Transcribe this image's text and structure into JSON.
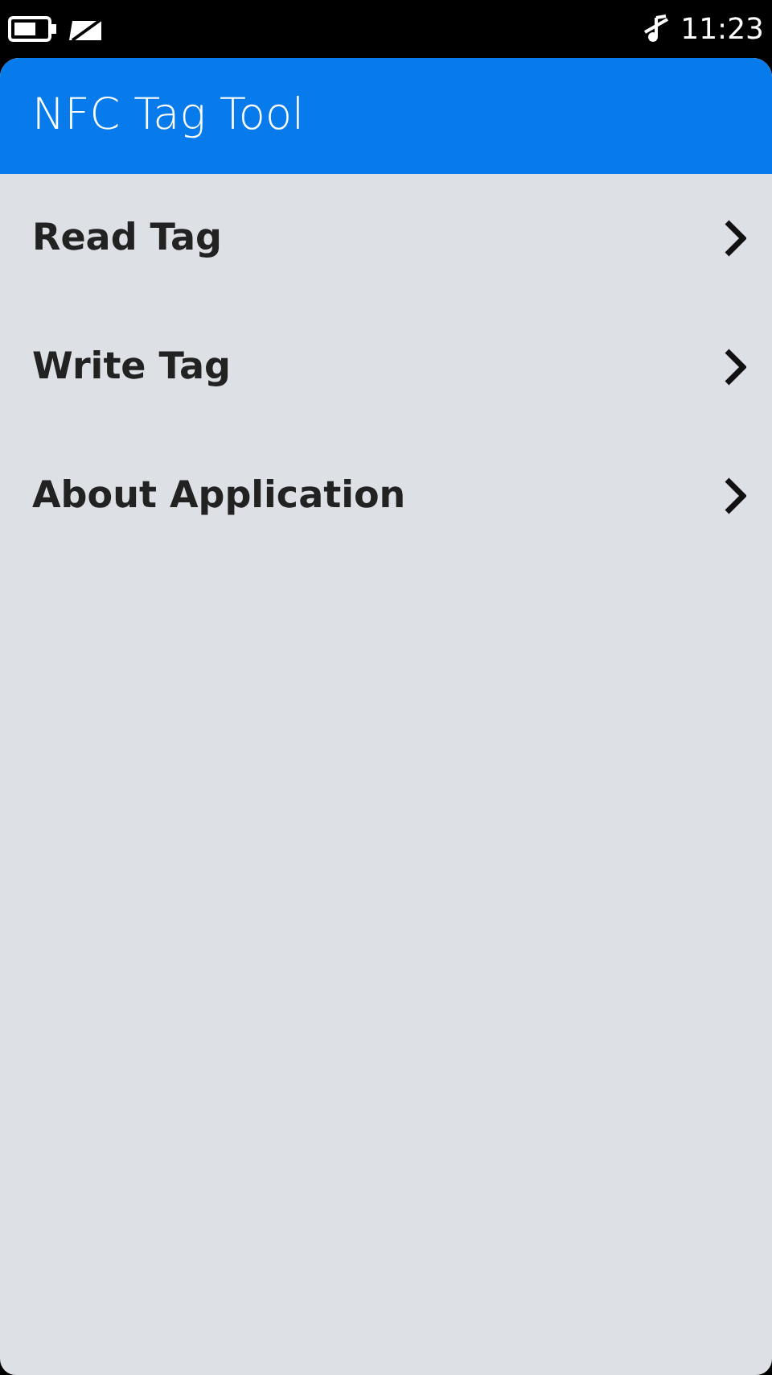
{
  "status_bar": {
    "time": "11:23"
  },
  "header": {
    "title": "NFC Tag Tool"
  },
  "menu": [
    {
      "label": "Read Tag"
    },
    {
      "label": "Write Tag"
    },
    {
      "label": "About Application"
    }
  ]
}
